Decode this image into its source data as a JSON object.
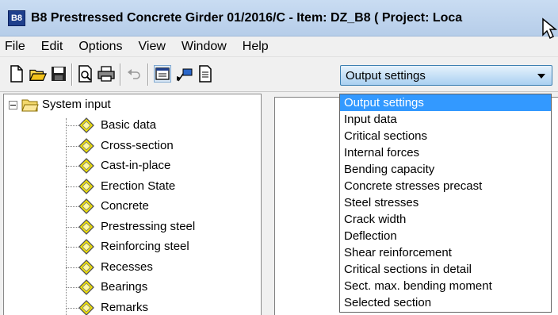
{
  "window": {
    "badge": "B8",
    "title": "B8 Prestressed Concrete Girder  01/2016/C - Item: DZ_B8 ( Project: Loca"
  },
  "menu": [
    "File",
    "Edit",
    "Options",
    "View",
    "Window",
    "Help"
  ],
  "toolbar": {
    "icons": [
      "new-document-icon",
      "open-folder-icon",
      "save-icon",
      "print-preview-icon",
      "print-icon",
      "undo-icon",
      "output-window-icon",
      "flag-icon",
      "document-icon"
    ],
    "output_combo": {
      "selected": "Output settings",
      "accent": "#3c7fb1"
    }
  },
  "tree": {
    "root": "System input",
    "items": [
      "Basic data",
      "Cross-section",
      "Cast-in-place",
      "Erection State",
      "Concrete",
      "Prestressing steel",
      "Reinforcing steel",
      "Recesses",
      "Bearings",
      "Remarks"
    ]
  },
  "dropdown": {
    "selected_index": 0,
    "highlight_color": "#3399ff",
    "options": [
      "Output settings",
      "Input data",
      "Critical sections",
      "Internal forces",
      "Bending capacity",
      "Concrete stresses precast",
      "Steel stresses",
      "Crack width",
      "Deflection",
      "Shear reinforcement",
      "Critical sections in detail",
      "Sect. max. bending moment",
      "Selected section"
    ]
  }
}
